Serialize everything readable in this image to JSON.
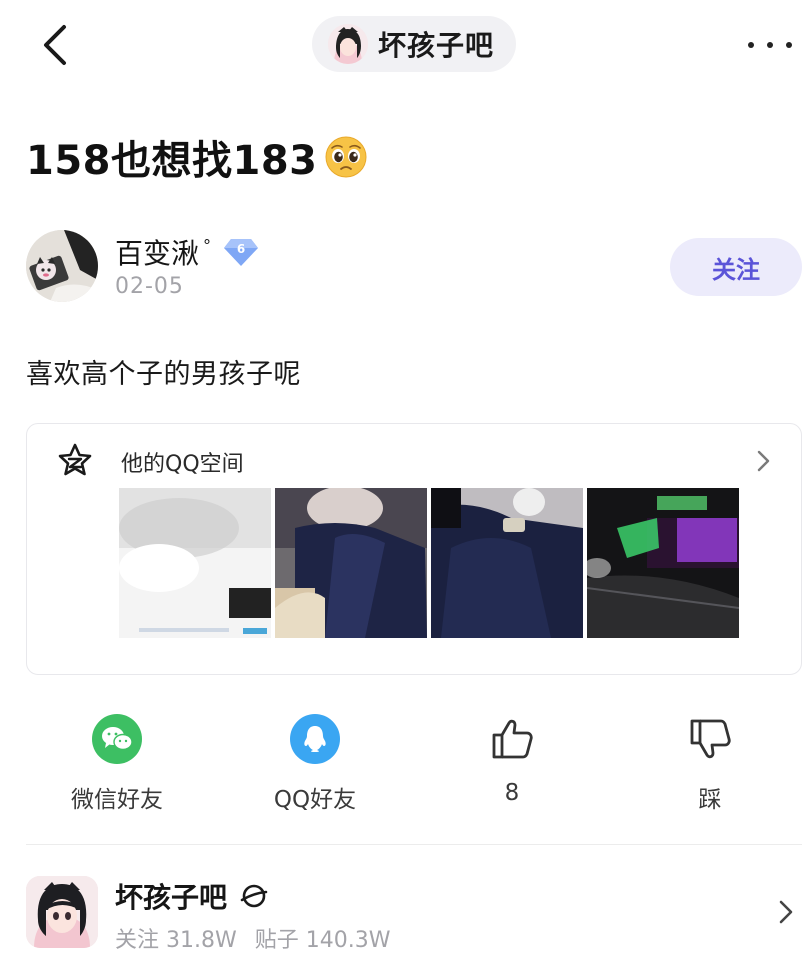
{
  "header": {
    "forum_name": "坏孩子吧",
    "back_icon": "chevron-left-icon",
    "more_icon": "more-dots-icon"
  },
  "post": {
    "title": "158也想找183",
    "title_emoji": "pleading-face-emoji",
    "body": "喜欢高个子的男孩子呢"
  },
  "author": {
    "name": "百变湫",
    "name_suffix": "°",
    "level": "6",
    "date": "02-05",
    "follow_label": "关注"
  },
  "qzone": {
    "title": "他的QQ空间",
    "photos": [
      "photo-1",
      "photo-2",
      "photo-3",
      "photo-4"
    ]
  },
  "share": {
    "wechat_label": "微信好友",
    "qq_label": "QQ好友",
    "like_count": "8",
    "dislike_label": "踩"
  },
  "forum_card": {
    "name": "坏孩子吧",
    "stats": [
      "关注 31.8W",
      "贴子 140.3W"
    ]
  },
  "colors": {
    "accent": "#5b54d8",
    "follow_bg": "#ecebfb",
    "wechat": "#3dbf63",
    "qq": "#3aa6f2",
    "muted_text": "#a3a3a8",
    "level_badge": "#7fa7f5"
  }
}
